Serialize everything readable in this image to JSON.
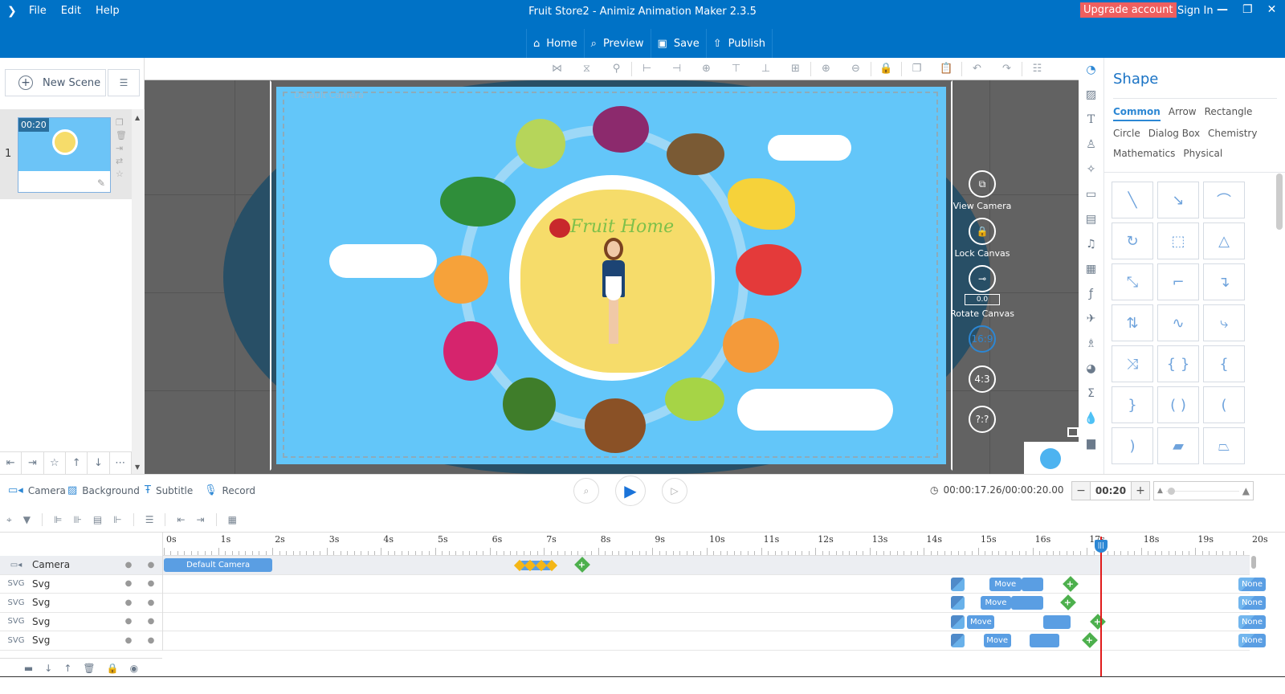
{
  "titlebar": {
    "app_title": "Fruit Store2 - Animiz Animation Maker 2.3.5",
    "menu": [
      "File",
      "Edit",
      "Help"
    ],
    "main_buttons": [
      {
        "label": "Home",
        "icon": "home-icon"
      },
      {
        "label": "Preview",
        "icon": "preview-icon"
      },
      {
        "label": "Save",
        "icon": "save-icon"
      },
      {
        "label": "Publish",
        "icon": "publish-icon"
      }
    ],
    "upgrade_label": "Upgrade account",
    "signin_label": "Sign In",
    "colors": {
      "bar": "#0072c6",
      "upgrade": "#ef5f5f"
    }
  },
  "scenes": {
    "new_scene_label": "New Scene",
    "items": [
      {
        "number": "1",
        "duration": "00:20"
      }
    ]
  },
  "canvas": {
    "camera_label": "Default Camera",
    "title_text": "Fruit Home",
    "controls": {
      "view_camera": "View Camera",
      "lock_canvas": "Lock Canvas",
      "rotate_canvas": "Rotate Canvas",
      "rotate_value": "0.0",
      "ratios": [
        "16:9",
        "4:3",
        "?:?"
      ],
      "active_ratio": "16:9"
    }
  },
  "shape_panel": {
    "title": "Shape",
    "categories": [
      "Common",
      "Arrow",
      "Rectangle",
      "Circle",
      "Dialog Box",
      "Chemistry",
      "Mathematics",
      "Physical"
    ],
    "active_category": "Common",
    "shapes": [
      "line",
      "arrow-line",
      "dashed-arc",
      "curved-arrow",
      "dashed-rect",
      "dashed-triangle",
      "double-arrow",
      "step-line",
      "step-arrow",
      "double-step-arrow",
      "s-curve",
      "s-curve-arrow",
      "double-curve-arrow",
      "curly-braces",
      "left-curly-brace",
      "right-curly-brace",
      "round-brackets",
      "left-round-bracket",
      "right-round-bracket",
      "parallelogram",
      "trapezoid"
    ]
  },
  "track_tools": {
    "camera": "Camera",
    "background": "Background",
    "subtitle": "Subtitle",
    "record": "Record"
  },
  "playback": {
    "time_current": "00:00:17.26",
    "time_total": "00:00:20.00",
    "time_display": "00:00:17.26/00:00:20.00",
    "zoom_value": "00:20",
    "playhead_seconds": 17.26
  },
  "timeline": {
    "ticks": [
      "0s",
      "1s",
      "2s",
      "3s",
      "4s",
      "5s",
      "6s",
      "7s",
      "8s",
      "9s",
      "10s",
      "11s",
      "12s",
      "13s",
      "14s",
      "15s",
      "16s",
      "17s",
      "18s",
      "19s",
      "20s"
    ],
    "layers": [
      {
        "name": "Camera",
        "type": "camera"
      },
      {
        "name": "Svg",
        "type": "svg"
      },
      {
        "name": "Svg",
        "type": "svg"
      },
      {
        "name": "Svg",
        "type": "svg"
      },
      {
        "name": "Svg",
        "type": "svg"
      }
    ],
    "camera_clip": {
      "label": "Default Camera",
      "start": 0,
      "end": 2.0
    },
    "camera_keyframes": [
      6.55,
      6.75,
      6.95,
      7.15
    ],
    "camera_add_keyframe": 7.7,
    "svg_tracks": [
      {
        "enter_at": 14.5,
        "move_label": "Move",
        "move": [
          15.2,
          15.8
        ],
        "clip2": [
          15.8,
          16.2
        ],
        "add_kf": 16.7,
        "exit_label": "None"
      },
      {
        "enter_at": 14.5,
        "move_label": "Move",
        "move": [
          15.05,
          15.6
        ],
        "clip2": [
          15.6,
          16.2
        ],
        "add_kf": 16.65,
        "exit_label": "None"
      },
      {
        "enter_at": 14.5,
        "move_label": "Move",
        "move": [
          14.8,
          15.3
        ],
        "clip2": [
          16.2,
          16.7
        ],
        "add_kf": 17.2,
        "exit_label": "None"
      },
      {
        "enter_at": 14.5,
        "move_label": "Move",
        "move": [
          15.1,
          15.6
        ],
        "clip2": [
          15.95,
          16.5
        ],
        "add_kf": 17.05,
        "exit_label": "None"
      }
    ]
  }
}
